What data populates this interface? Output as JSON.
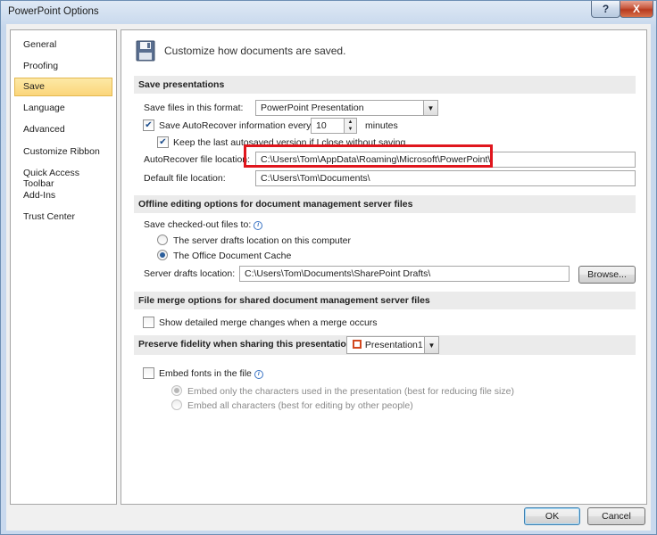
{
  "window": {
    "title": "PowerPoint Options",
    "help_glyph": "?",
    "close_glyph": "X"
  },
  "nav": {
    "items": [
      {
        "label": "General",
        "selected": false
      },
      {
        "label": "Proofing",
        "selected": false
      },
      {
        "label": "Save",
        "selected": true
      },
      {
        "label": "Language",
        "selected": false
      },
      {
        "label": "Advanced",
        "selected": false
      },
      {
        "label": "Customize Ribbon",
        "selected": false
      },
      {
        "label": "Quick Access Toolbar",
        "selected": false
      },
      {
        "label": "Add-Ins",
        "selected": false
      },
      {
        "label": "Trust Center",
        "selected": false
      }
    ]
  },
  "header": {
    "label": "Customize how documents are saved.",
    "icon": "floppy-disk-icon"
  },
  "save_presentations": {
    "heading": "Save presentations",
    "format_label": "Save files in this format:",
    "format_value": "PowerPoint Presentation",
    "autorecover_label": "Save AutoRecover information every",
    "autorecover_checked": true,
    "autorecover_minutes": "10",
    "minutes_label": "minutes",
    "keep_last_label": "Keep the last autosaved version if I close without saving",
    "keep_last_checked": true,
    "autorecover_location_label": "AutoRecover file location:",
    "autorecover_location_value": "C:\\Users\\Tom\\AppData\\Roaming\\Microsoft\\PowerPoint\\",
    "default_location_label": "Default file location:",
    "default_location_value": "C:\\Users\\Tom\\Documents\\"
  },
  "offline": {
    "heading": "Offline editing options for document management server files",
    "checked_out_label": "Save checked-out files to:",
    "option1_label": "The server drafts location on this computer",
    "option2_label": "The Office Document Cache",
    "selected_option": 2,
    "drafts_label": "Server drafts location:",
    "drafts_value": "C:\\Users\\Tom\\Documents\\SharePoint Drafts\\",
    "browse_label": "Browse..."
  },
  "file_merge": {
    "heading": "File merge options for shared document management server files",
    "show_merge_label": "Show detailed merge changes when a merge occurs",
    "show_merge_checked": false
  },
  "fidelity": {
    "heading": "Preserve fidelity when sharing this presentation:",
    "presentation_value": "Presentation1",
    "embed_fonts_label": "Embed fonts in the file",
    "embed_fonts_checked": false,
    "embed_only_label": "Embed only the characters used in the presentation (best for reducing file size)",
    "embed_all_label": "Embed all characters (best for editing by other people)"
  },
  "footer": {
    "ok_label": "OK",
    "cancel_label": "Cancel"
  }
}
